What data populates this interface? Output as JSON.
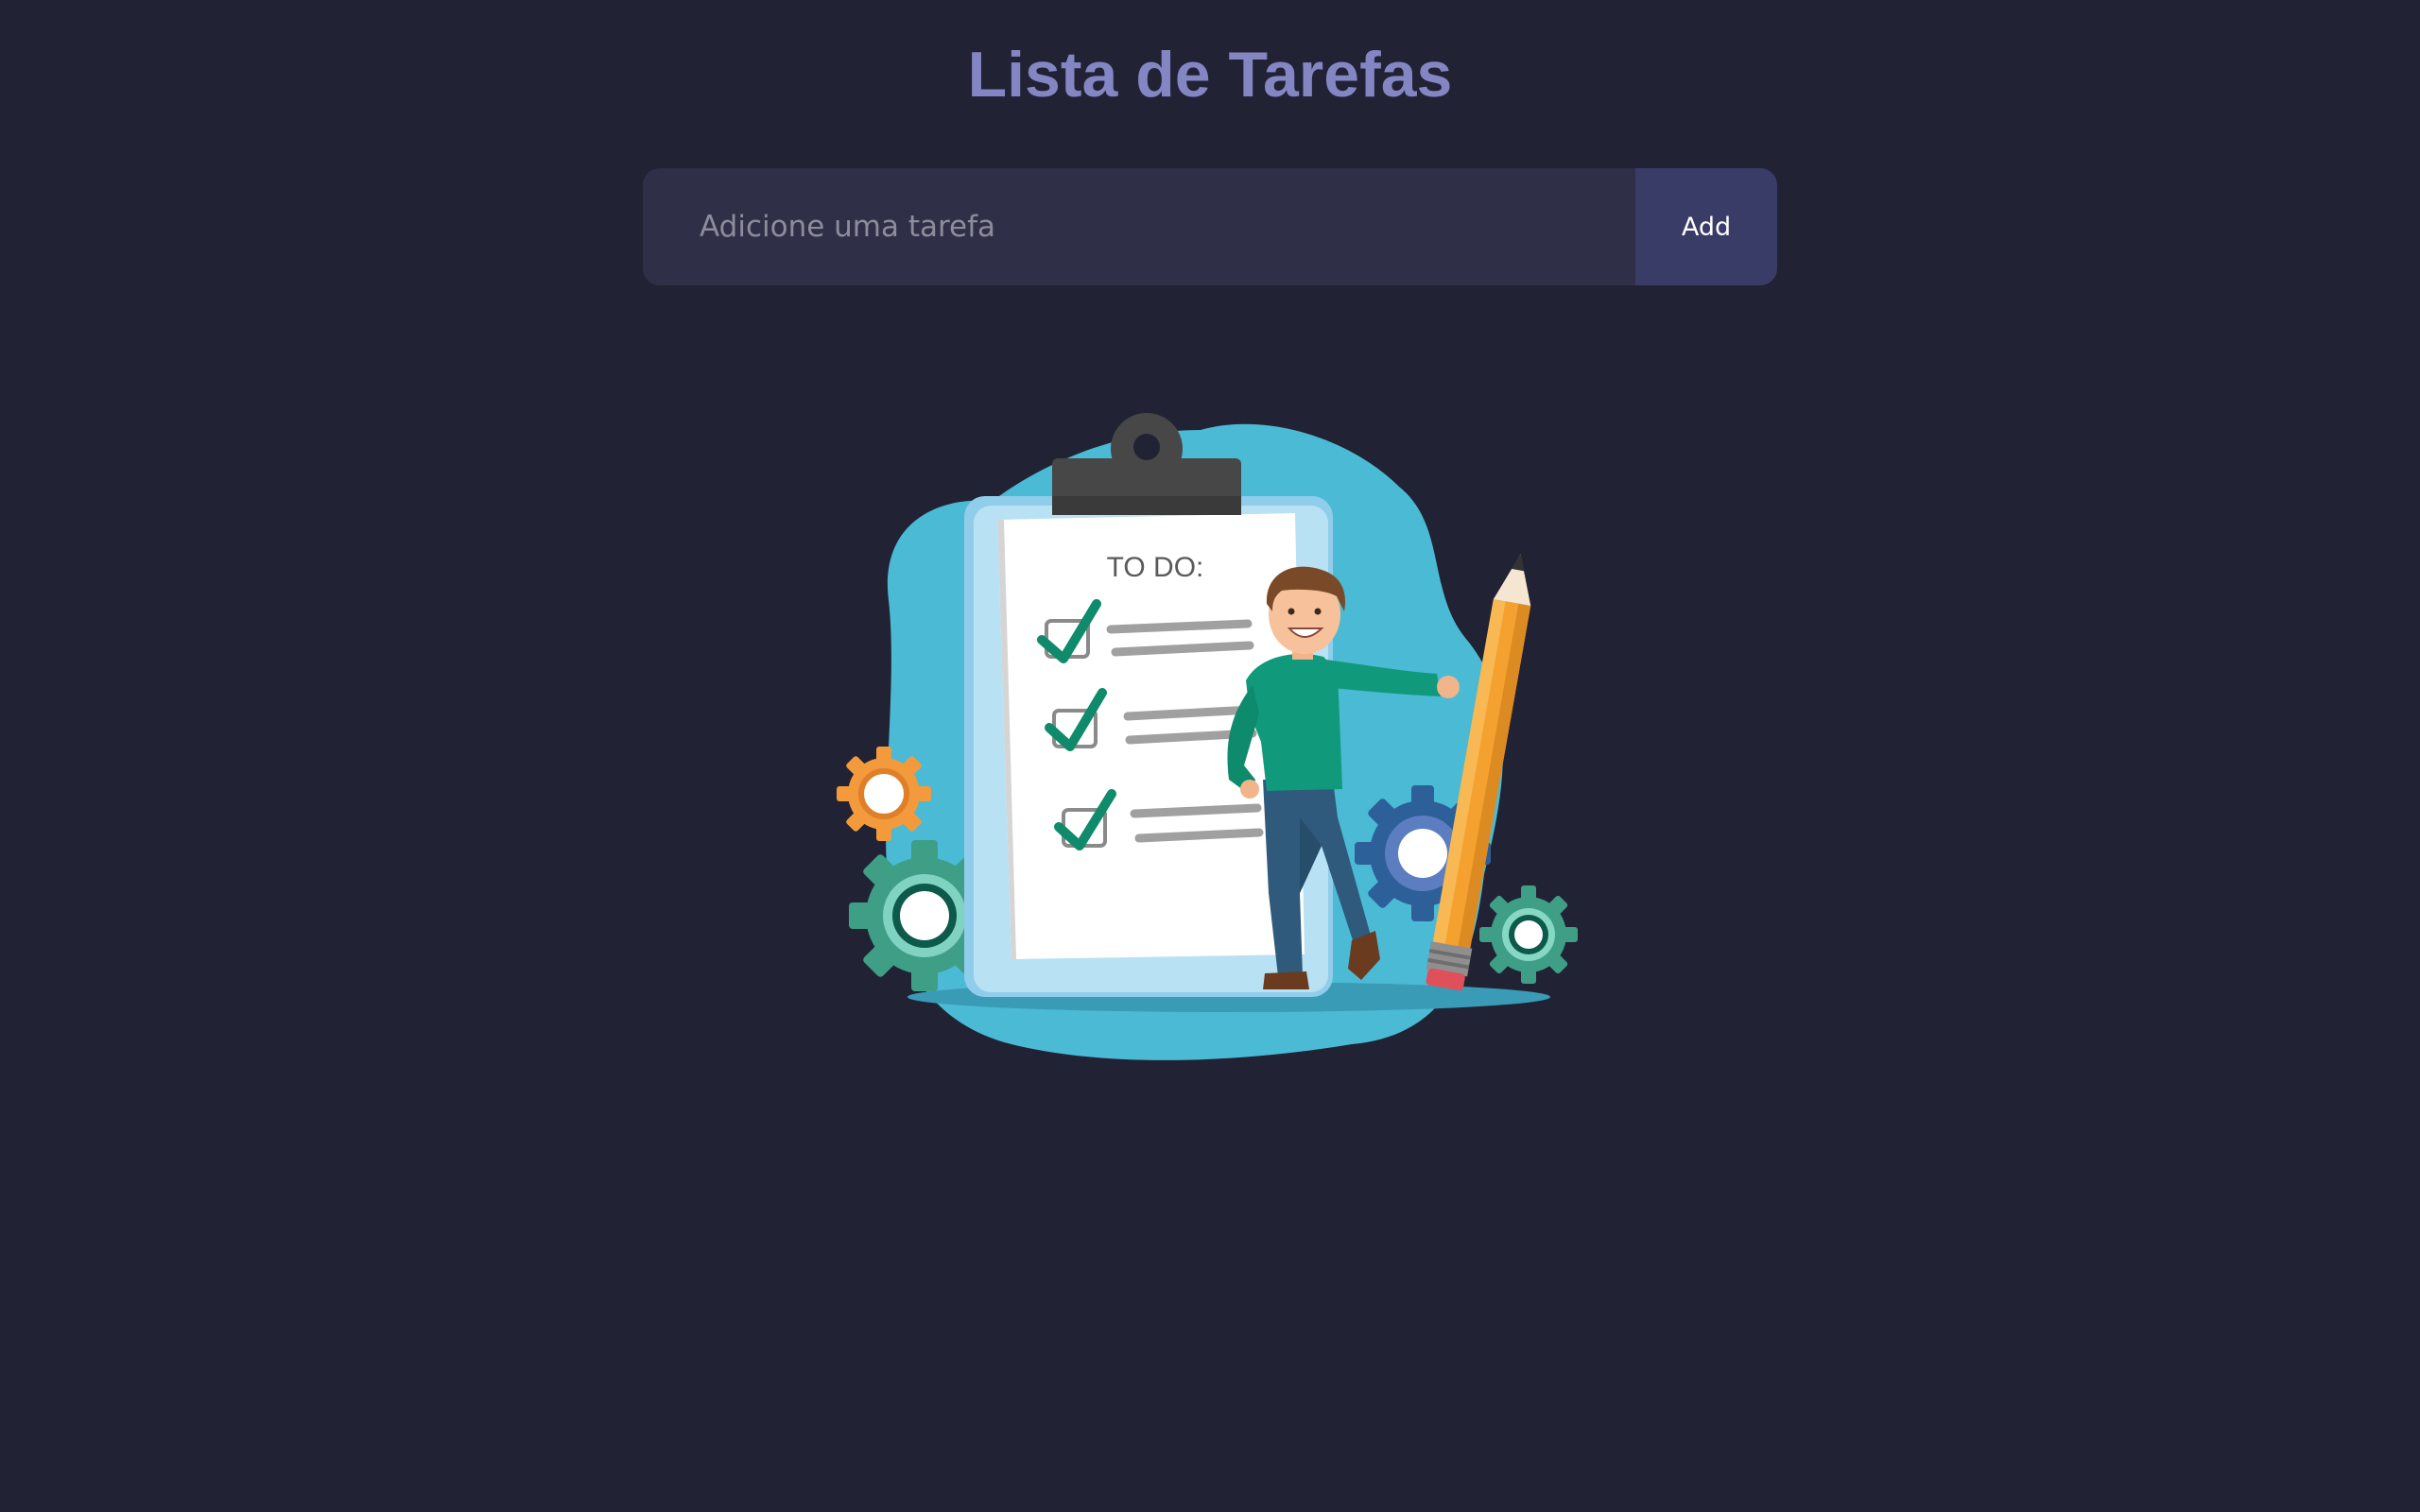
{
  "header": {
    "title": "Lista de Tarefas"
  },
  "task_form": {
    "input_value": "",
    "input_placeholder": "Adicione uma tarefa",
    "add_label": "Add"
  },
  "illustration": {
    "clipboard_heading": "TO DO:",
    "checked_items": 3
  },
  "colors": {
    "background": "#212234",
    "title": "#8386c3",
    "input_background": "#2f3048",
    "button_background": "#3a3c68",
    "blob": "#4bbad5",
    "check": "#0f8a6a",
    "shirt": "#10997a",
    "pencil": "#f5a12f"
  }
}
